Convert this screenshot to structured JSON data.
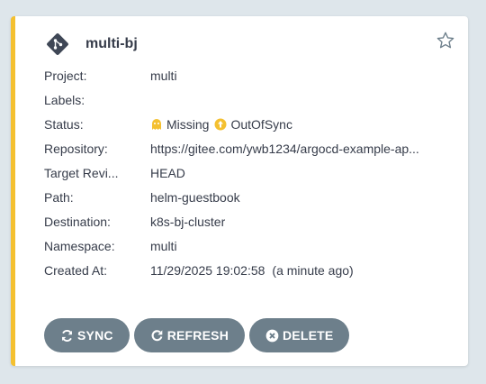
{
  "app": {
    "name": "multi-bj",
    "icon": "git-branch-icon"
  },
  "favorite_icon": "star-outline-icon",
  "fields": [
    {
      "label": "Project:",
      "value": "multi"
    },
    {
      "label": "Labels:",
      "value": ""
    },
    {
      "label": "Status:",
      "health": "Missing",
      "health_icon": "ghost-icon",
      "sync": "OutOfSync",
      "sync_icon": "arrow-up-circle-icon"
    },
    {
      "label": "Repository:",
      "value": "https://gitee.com/ywb1234/argocd-example-ap..."
    },
    {
      "label": "Target Revi...",
      "value": "HEAD"
    },
    {
      "label": "Path:",
      "value": "helm-guestbook"
    },
    {
      "label": "Destination:",
      "value": "k8s-bj-cluster"
    },
    {
      "label": "Namespace:",
      "value": "multi"
    },
    {
      "label": "Created At:",
      "value": "11/29/2025 19:02:58",
      "relative": "(a minute ago)"
    }
  ],
  "actions": {
    "sync": "SYNC",
    "refresh": "REFRESH",
    "delete": "DELETE"
  },
  "colors": {
    "accent_border": "#f4c030",
    "button_bg": "#6d7f8b",
    "status_yellow": "#f4c030"
  }
}
